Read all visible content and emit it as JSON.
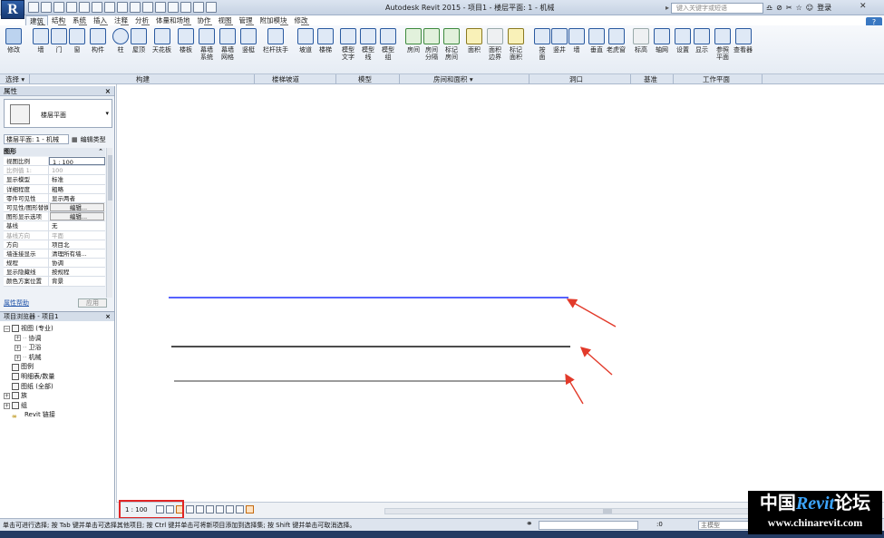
{
  "app": {
    "logo_letter": "R",
    "title": "Autodesk Revit 2015 -   项目1 - 楼层平面: 1 - 机械",
    "search_placeholder": "键入关键字或短语",
    "user_label": "登录",
    "help_label": "?"
  },
  "tabs": [
    {
      "label": "建筑",
      "key": "A",
      "active": true
    },
    {
      "label": "结构",
      "key": "S"
    },
    {
      "label": "系统",
      "key": "Y"
    },
    {
      "label": "插入",
      "key": "I"
    },
    {
      "label": "注释",
      "key": "N"
    },
    {
      "label": "分析",
      "key": "L"
    },
    {
      "label": "体量和场地",
      "key": "M"
    },
    {
      "label": "协作",
      "key": "C"
    },
    {
      "label": "视图",
      "key": "V"
    },
    {
      "label": "管理",
      "key": "G"
    },
    {
      "label": "附加模块",
      "key": "X2"
    },
    {
      "label": "修改",
      "key": "X3"
    }
  ],
  "ribbon": {
    "buttons": [
      {
        "label": "修改",
        "sub": ""
      },
      {
        "label": "墙",
        "sub": ""
      },
      {
        "label": "门",
        "sub": ""
      },
      {
        "label": "窗",
        "sub": ""
      },
      {
        "label": "构件",
        "sub": ""
      },
      {
        "label": "柱",
        "sub": ""
      },
      {
        "label": "屋顶",
        "sub": ""
      },
      {
        "label": "天花板",
        "sub": ""
      },
      {
        "label": "楼板",
        "sub": ""
      },
      {
        "label": "幕墙",
        "sub": "系统"
      },
      {
        "label": "幕墙",
        "sub": "网格"
      },
      {
        "label": "竖梃",
        "sub": ""
      },
      {
        "label": "栏杆扶手",
        "sub": ""
      },
      {
        "label": "坡道",
        "sub": ""
      },
      {
        "label": "楼梯",
        "sub": ""
      },
      {
        "label": "模型",
        "sub": "文字"
      },
      {
        "label": "模型",
        "sub": "线"
      },
      {
        "label": "模型",
        "sub": "组"
      },
      {
        "label": "房间",
        "sub": ""
      },
      {
        "label": "房间",
        "sub": "分隔"
      },
      {
        "label": "标记",
        "sub": "房间"
      },
      {
        "label": "面积",
        "sub": ""
      },
      {
        "label": "面积",
        "sub": "边界"
      },
      {
        "label": "标记",
        "sub": "面积"
      },
      {
        "label": "按",
        "sub": "面"
      },
      {
        "label": "竖井",
        "sub": ""
      },
      {
        "label": "墙",
        "sub": ""
      },
      {
        "label": "垂直",
        "sub": ""
      },
      {
        "label": "老虎窗",
        "sub": ""
      },
      {
        "label": "标高",
        "sub": ""
      },
      {
        "label": "轴网",
        "sub": ""
      },
      {
        "label": "设置",
        "sub": ""
      },
      {
        "label": "显示",
        "sub": ""
      },
      {
        "label": "参照",
        "sub": "平面"
      },
      {
        "label": "查看器",
        "sub": ""
      }
    ],
    "panels": [
      "选择 ▾",
      "构建",
      "楼梯坡道",
      "模型",
      "房间和面积 ▾",
      "洞口",
      "基准",
      "工作平面"
    ]
  },
  "properties": {
    "title": "属性",
    "type_name": "楼层平面",
    "instance_selector": "楼层平面: 1 - 机械",
    "edit_type": "编辑类型",
    "group": "图形",
    "rows": [
      {
        "k": "视图比例",
        "v": "1 : 100"
      },
      {
        "k": "比例值 1:",
        "v": "100",
        "dim": true
      },
      {
        "k": "显示模型",
        "v": "标准"
      },
      {
        "k": "详细程度",
        "v": "粗略"
      },
      {
        "k": "零件可见性",
        "v": "显示两者"
      },
      {
        "k": "可见性/图形替换",
        "v": "编辑...",
        "btn": true
      },
      {
        "k": "图形显示选项",
        "v": "编辑...",
        "btn": true
      },
      {
        "k": "基线",
        "v": "无"
      },
      {
        "k": "基线方向",
        "v": "平面",
        "dim": true
      },
      {
        "k": "方向",
        "v": "项目北"
      },
      {
        "k": "墙连接显示",
        "v": "清理所有墙..."
      },
      {
        "k": "规程",
        "v": "协调"
      },
      {
        "k": "显示隐藏线",
        "v": "按规程"
      },
      {
        "k": "颜色方案位置",
        "v": "背景"
      }
    ],
    "help_link": "属性帮助",
    "apply": "应用"
  },
  "browser": {
    "title": "项目浏览器 - 项目1",
    "nodes": [
      {
        "label": "视图 (专业)",
        "exp": "−",
        "depth": 0,
        "icon": true
      },
      {
        "label": "协调",
        "exp": "+",
        "depth": 1
      },
      {
        "label": "卫浴",
        "exp": "+",
        "depth": 1
      },
      {
        "label": "机械",
        "exp": "+",
        "depth": 1
      },
      {
        "label": "图例",
        "exp": "",
        "depth": 0,
        "icon": true
      },
      {
        "label": "明细表/数量",
        "exp": "",
        "depth": 0,
        "icon": true
      },
      {
        "label": "图纸 (全部)",
        "exp": "",
        "depth": 0,
        "icon": true
      },
      {
        "label": "族",
        "exp": "+",
        "depth": 0,
        "icon": true
      },
      {
        "label": "组",
        "exp": "+",
        "depth": 0,
        "icon": true
      },
      {
        "label": "Revit 链接",
        "exp": "",
        "depth": 0,
        "link": true
      }
    ]
  },
  "colors": {
    "line_blue": "#1f2fff",
    "line_black": "#111111",
    "line_gray": "#7a7a7a",
    "annotation_red": "#e23a2a"
  },
  "view_bar": {
    "scale": "1 : 100"
  },
  "status": {
    "message": "单击可进行选择; 按 Tab 键并单击可选择其他项目; 按 Ctrl 键并单击可将新项目添加到选择集; 按 Shift 键并单击可取消选择。",
    "filter_count": ":0",
    "model": "主模型"
  },
  "watermark": {
    "cn1": "中国",
    "rv": "Revit",
    "cn2": "论坛",
    "url": "www.chinarevit.com"
  }
}
